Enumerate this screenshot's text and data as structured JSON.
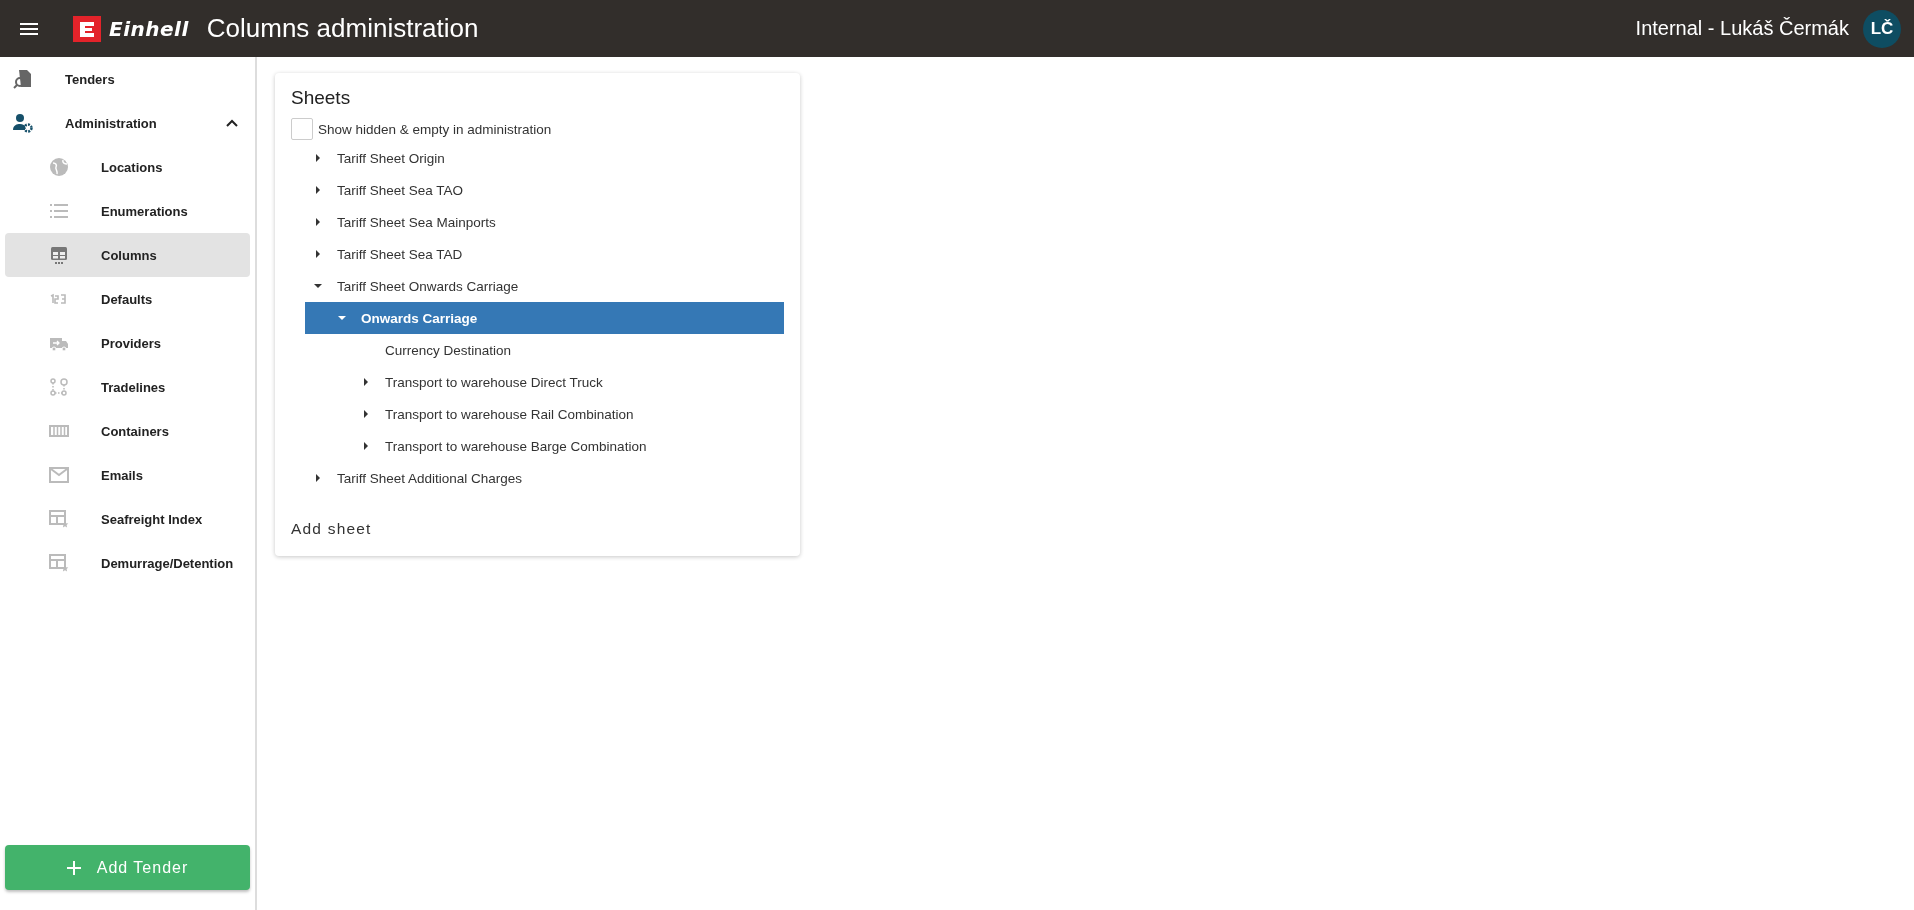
{
  "header": {
    "logo": "Einhell",
    "title": "Columns administration",
    "user": "Internal - Lukáš Čermák",
    "avatar": "LČ"
  },
  "sidebar": {
    "items": [
      {
        "label": "Tenders",
        "selected": false
      },
      {
        "label": "Administration",
        "selected": false,
        "expanded": true,
        "children": [
          {
            "label": "Locations",
            "selected": false
          },
          {
            "label": "Enumerations",
            "selected": false
          },
          {
            "label": "Columns",
            "selected": true
          },
          {
            "label": "Defaults",
            "selected": false
          },
          {
            "label": "Providers",
            "selected": false
          },
          {
            "label": "Tradelines",
            "selected": false
          },
          {
            "label": "Containers",
            "selected": false
          },
          {
            "label": "Emails",
            "selected": false
          },
          {
            "label": "Seafreight Index",
            "selected": false
          },
          {
            "label": "Demurrage/Detention",
            "selected": false
          }
        ]
      }
    ],
    "add_button": "Add Tender"
  },
  "card": {
    "title": "Sheets",
    "checkbox": {
      "label": "Show hidden & empty in administration",
      "checked": false
    },
    "tree": [
      {
        "label": "Tariff Sheet Origin",
        "kind": "group",
        "expanded": false,
        "selected": false
      },
      {
        "label": "Tariff Sheet Sea TAO",
        "kind": "group",
        "expanded": false,
        "selected": false
      },
      {
        "label": "Tariff Sheet Sea Mainports",
        "kind": "group",
        "expanded": false,
        "selected": false
      },
      {
        "label": "Tariff Sheet Sea TAD",
        "kind": "group",
        "expanded": false,
        "selected": false
      },
      {
        "label": "Tariff Sheet Onwards Carriage",
        "kind": "group",
        "expanded": true,
        "selected": false,
        "children": [
          {
            "label": "Onwards Carriage",
            "kind": "group",
            "expanded": true,
            "selected": true,
            "children": [
              {
                "label": "Currency Destination",
                "kind": "leaf",
                "selected": false
              },
              {
                "label": "Transport to warehouse Direct Truck",
                "kind": "group",
                "expanded": false,
                "selected": false
              },
              {
                "label": "Transport to warehouse Rail Combination",
                "kind": "group",
                "expanded": false,
                "selected": false
              },
              {
                "label": "Transport to warehouse Barge Combination",
                "kind": "group",
                "expanded": false,
                "selected": false
              }
            ]
          }
        ]
      },
      {
        "label": "Tariff Sheet Additional Charges",
        "kind": "group",
        "expanded": false,
        "selected": false
      }
    ],
    "add_button": "Add sheet"
  }
}
